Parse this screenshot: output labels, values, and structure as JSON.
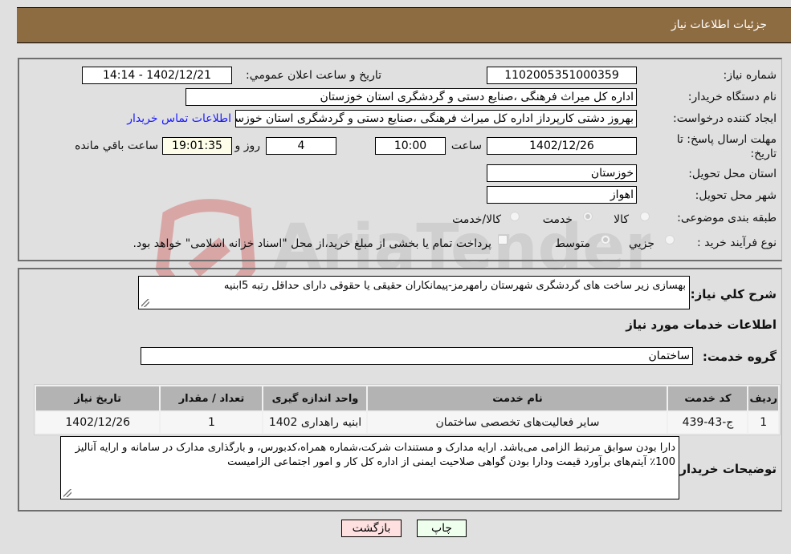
{
  "header": {
    "title": "جزئیات اطلاعات نیاز"
  },
  "form": {
    "need_number": {
      "label": "شماره نیاز:",
      "value": "1102005351000359"
    },
    "announce_datetime": {
      "label": "تاریخ و ساعت اعلان عمومي:",
      "value": "1402/12/21 - 14:14"
    },
    "buyer_org": {
      "label": "نام دستگاه خریدار:",
      "value": "اداره کل میراث فرهنگی ،صنایع دستی و گردشگری استان خوزستان"
    },
    "requester": {
      "label": "ایجاد کننده درخواست:",
      "value": "بهروز دشتی کارپرداز اداره کل میراث فرهنگی ،صنایع دستی و گردشگری استان خوزستان",
      "contact_link": "اطلاعات تماس خریدار"
    },
    "deadline": {
      "label": "مهلت ارسال پاسخ: تا تاریخ:",
      "date": "1402/12/26",
      "time_label": "ساعت",
      "time": "10:00",
      "days": "4",
      "days_label": "روز و",
      "remaining": "19:01:35",
      "remaining_label": "ساعت باقي مانده"
    },
    "delivery_province": {
      "label": "استان محل تحویل:",
      "value": "خوزستان"
    },
    "delivery_city": {
      "label": "شهر محل تحویل:",
      "value": "اهواز"
    },
    "category": {
      "label": "طبقه بندی موضوعی:",
      "options": [
        "کالا",
        "خدمت",
        "کالا/خدمت"
      ],
      "selected": "خدمت"
    },
    "purchase_type": {
      "label": "نوع فرآیند خرید :",
      "options": [
        "جزيي",
        "متوسط"
      ],
      "selected": "متوسط",
      "treasury_note": "پرداخت تمام یا بخشی از مبلغ خرید،از محل \"اسناد خزانه اسلامی\" خواهد بود."
    }
  },
  "details": {
    "description_label": "شرح کلي نیاز:",
    "description": "بهسازی زیر ساخت های گردشگری شهرستان رامهرمز-پیمانکاران حقیقی یا حقوقی دارای حداقل رتبه 5ابنیه",
    "services_title": "اطلاعات خدمات مورد نیاز",
    "service_group_label": "گروه خدمت:",
    "service_group": "ساختمان",
    "table": {
      "headers": [
        "ردیف",
        "کد خدمت",
        "نام خدمت",
        "واحد اندازه گیری",
        "تعداد / مقدار",
        "تاریخ نیاز"
      ],
      "rows": [
        [
          "1",
          "ج-43-439",
          "سایر فعالیت‌های تخصصی ساختمان",
          "ابنیه راهداری 1402",
          "1",
          "1402/12/26"
        ]
      ]
    },
    "buyer_notes_label": "توضیحات خریدار:",
    "buyer_notes": "دارا بودن سوابق مرتبط الزامی می‌باشد. ارایه مدارک و مستندات شرکت،شماره همراه،کدبورس، و بارگذاری مدارک در سامانه و ارایه آنالیز 100٪ آیتم‌های برآورد قیمت ودارا بودن گواهی صلاحیت ایمنی از اداره کل کار و امور اجتماعی الزامیست"
  },
  "buttons": {
    "print": "چاپ",
    "back": "بازگشت"
  },
  "watermark": {
    "text": "AriaTender.neT"
  },
  "colors": {
    "header_bg": "#8e6c42",
    "link": "#1a1aff",
    "print_bg": "#eeffee",
    "back_bg": "#ffe0e0"
  }
}
